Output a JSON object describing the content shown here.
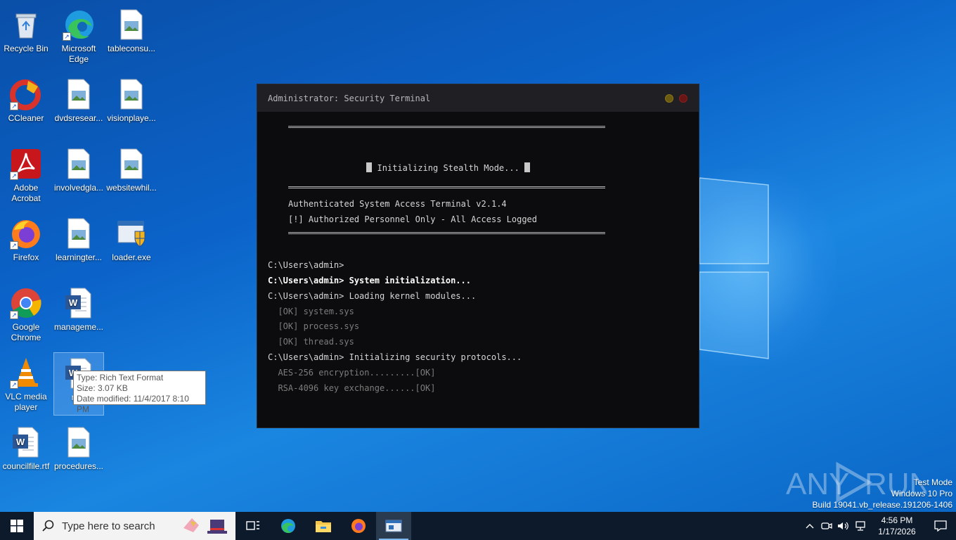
{
  "desktop": {
    "icons": [
      {
        "label": "Recycle Bin"
      },
      {
        "label": "Microsoft Edge"
      },
      {
        "label": "tableconsu..."
      },
      {
        "label": "CCleaner"
      },
      {
        "label": "dvdsresear..."
      },
      {
        "label": "visionplaye..."
      },
      {
        "label": "Adobe Acrobat"
      },
      {
        "label": "involvedgla..."
      },
      {
        "label": "websitewhil..."
      },
      {
        "label": "Firefox"
      },
      {
        "label": "learningter..."
      },
      {
        "label": "loader.exe"
      },
      {
        "label": "Google Chrome"
      },
      {
        "label": "manageme..."
      },
      {
        "label": "VLC media player"
      },
      {
        "label": "mar"
      },
      {
        "label": "councilfile.rtf"
      },
      {
        "label": "procedures..."
      }
    ],
    "tooltip": {
      "type": "Type: Rich Text Format",
      "size": "Size: 3.07 KB",
      "modified": "Date modified: 11/4/2017 8:10 PM"
    }
  },
  "terminal": {
    "title": "Administrator: Security Terminal",
    "banner_text": "Initializing Stealth Mode...",
    "header_line1": "Authenticated System Access Terminal v2.1.4",
    "header_line2": "[!] Authorized Personnel Only - All Access Logged",
    "lines": [
      "C:\\Users\\admin>",
      "C:\\Users\\admin> System initialization...",
      "C:\\Users\\admin> Loading kernel modules...",
      "  [OK] system.sys",
      "  [OK] process.sys",
      "  [OK] thread.sys",
      "C:\\Users\\admin> Initializing security protocols...",
      "  AES-256 encryption.........[OK]",
      "  RSA-4096 key exchange......[OK]"
    ]
  },
  "watermark": {
    "brand_left": "ANY",
    "brand_right": "RUN",
    "mode": "Test Mode",
    "edition": "Windows 10 Pro",
    "build": "Build 19041.vb_release.191206-1406"
  },
  "taskbar": {
    "search_placeholder": "Type here to search",
    "time": "4:56 PM",
    "date": "1/17/2026"
  },
  "colors": {
    "desktop_blue": "#0b63c9",
    "taskbar": "#0c1a2c",
    "terminal_bg": "#0c0c0e"
  }
}
